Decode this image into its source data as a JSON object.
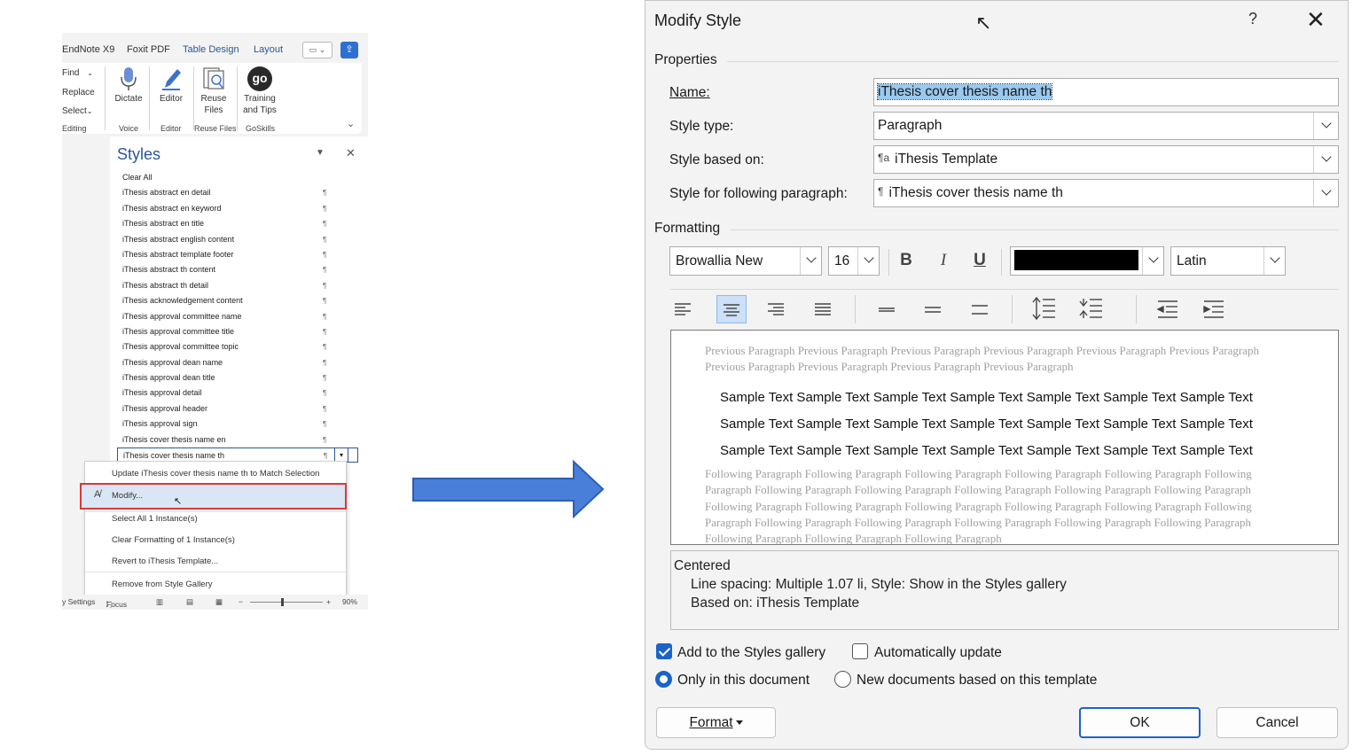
{
  "word": {
    "tabs": [
      "EndNote X9",
      "Foxit PDF",
      "Table Design",
      "Layout"
    ],
    "editing_items": [
      "Find",
      "Replace",
      "Select"
    ],
    "ribbon_buttons": [
      {
        "label": "Dictate",
        "icon": "microphone-icon"
      },
      {
        "label": "Editor",
        "icon": "pen-icon"
      },
      {
        "label": "Reuse Files",
        "icon": "reuse-files-icon"
      },
      {
        "label": "Training and Tips",
        "icon": "goskills-icon",
        "icon_text": "go"
      }
    ],
    "group_labels": [
      "Editing",
      "Voice",
      "Editor",
      "Reuse Files",
      "GoSkills"
    ],
    "styles_pane": {
      "title": "Styles",
      "items": [
        "Clear All",
        "iThesis abstract en detail",
        "iThesis abstract en keyword",
        "iThesis abstract en title",
        "iThesis abstract english content",
        "iThesis abstract template footer",
        "iThesis abstract th content",
        "iThesis abstract th detail",
        "iThesis acknowledgement content",
        "iThesis approval committee name",
        "iThesis approval committee title",
        "iThesis approval committee topic",
        "iThesis approval dean name",
        "iThesis approval dean title",
        "iThesis approval detail",
        "iThesis approval header",
        "iThesis approval sign",
        "iThesis cover thesis name en",
        "iThesis cover thesis name th"
      ],
      "paragraph_mark": "¶"
    },
    "context_menu": {
      "update": "Update iThesis cover thesis name th to Match Selection",
      "modify": "Modify...",
      "select_all": "Select All 1 Instance(s)",
      "clear_formatting": "Clear Formatting of 1 Instance(s)",
      "revert": "Revert to iThesis Template...",
      "remove": "Remove from Style Gallery"
    },
    "status_bar": {
      "settings": "y Settings",
      "focus": "Focus",
      "zoom": "90%"
    },
    "colors": {
      "accent": "#2b5797",
      "highlight_border": "#d63a3a",
      "share_button": "#2f6fd1"
    }
  },
  "arrow": {
    "color": "#4a7fd9"
  },
  "dialog": {
    "title": "Modify Style",
    "help": "?",
    "properties": {
      "header": "Properties",
      "name_label": "Name:",
      "name_value": "iThesis cover thesis name th",
      "style_type_label": "Style type:",
      "style_type_value": "Paragraph",
      "based_on_label": "Style based on:",
      "based_on_value": "iThesis Template",
      "following_label": "Style for following paragraph:",
      "following_value": "iThesis cover thesis name th"
    },
    "formatting": {
      "header": "Formatting",
      "font": "Browallia New",
      "size": "16",
      "bold": "B",
      "italic": "I",
      "underline": "U",
      "font_color": "#000000",
      "script": "Latin",
      "active_alignment": "center"
    },
    "preview": {
      "previous": "Previous Paragraph Previous Paragraph Previous Paragraph Previous Paragraph Previous Paragraph Previous Paragraph Previous Paragraph Previous Paragraph Previous Paragraph Previous Paragraph",
      "sample_line": "Sample Text Sample Text Sample Text Sample Text Sample Text Sample Text Sample Text",
      "following": "Following Paragraph Following Paragraph Following Paragraph Following Paragraph Following Paragraph Following Paragraph Following Paragraph Following Paragraph Following Paragraph Following Paragraph Following Paragraph Following Paragraph Following Paragraph Following Paragraph Following Paragraph Following Paragraph Following Paragraph Following Paragraph Following Paragraph Following Paragraph Following Paragraph Following Paragraph Following Paragraph Following Paragraph Following Paragraph"
    },
    "description": {
      "line1": "Centered",
      "line2": "Line spacing:  Multiple 1.07 li, Style: Show in the Styles gallery",
      "line3": "Based on: iThesis Template"
    },
    "options": {
      "add_to_gallery": "Add to the Styles gallery",
      "add_to_gallery_checked": true,
      "auto_update": "Automatically update",
      "auto_update_checked": false,
      "only_this_doc": "Only in this document",
      "new_docs": "New documents based on this template",
      "selected_scope": "only_this_doc"
    },
    "buttons": {
      "format": "Format",
      "ok": "OK",
      "cancel": "Cancel"
    },
    "colors": {
      "accent": "#1a64c8",
      "selection": "#99c9ef",
      "active_button": "#cce0f7"
    }
  }
}
